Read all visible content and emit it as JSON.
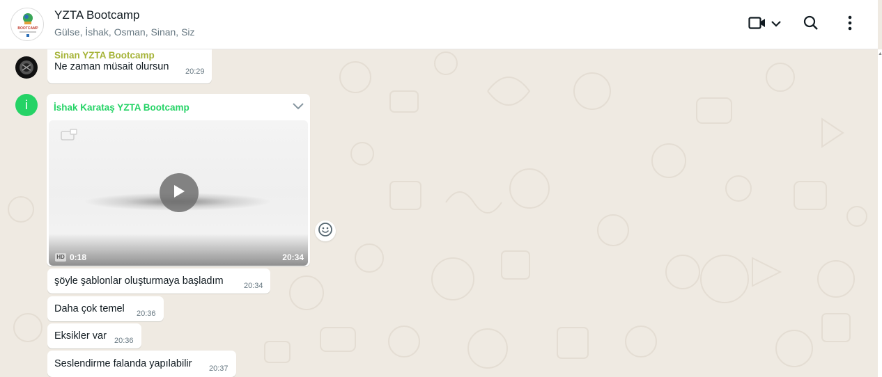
{
  "header": {
    "title": "YZTA Bootcamp",
    "subtitle": "Gülse, İshak, Osman, Sinan, Siz",
    "avatar_text": "BOOTCAMP",
    "icons": [
      "video-call-icon",
      "chevron-down-icon",
      "search-icon",
      "more-options-icon"
    ]
  },
  "messages": [
    {
      "sender": "Sinan YZTA Bootcamp",
      "sender_color": "#a5b337",
      "text": "Ne zaman müsait olursun",
      "time": "20:29"
    },
    {
      "sender": "İshak Karataş YZTA Bootcamp",
      "sender_color": "#25d366",
      "avatar_letter": "i",
      "video": {
        "duration": "0:18",
        "time": "20:34",
        "quality_badge": "HD"
      }
    },
    {
      "text": "şöyle şablonlar oluşturmaya başladım",
      "time": "20:34"
    },
    {
      "text": "Daha çok temel",
      "time": "20:36"
    },
    {
      "text": "Eksikler var",
      "time": "20:36"
    },
    {
      "text": "Seslendirme falanda yapılabilir",
      "time": "20:37"
    }
  ],
  "colors": {
    "chat_background": "#efeae2",
    "bubble": "#ffffff",
    "ishak_avatar": "#25d366",
    "text_secondary": "#667781"
  }
}
